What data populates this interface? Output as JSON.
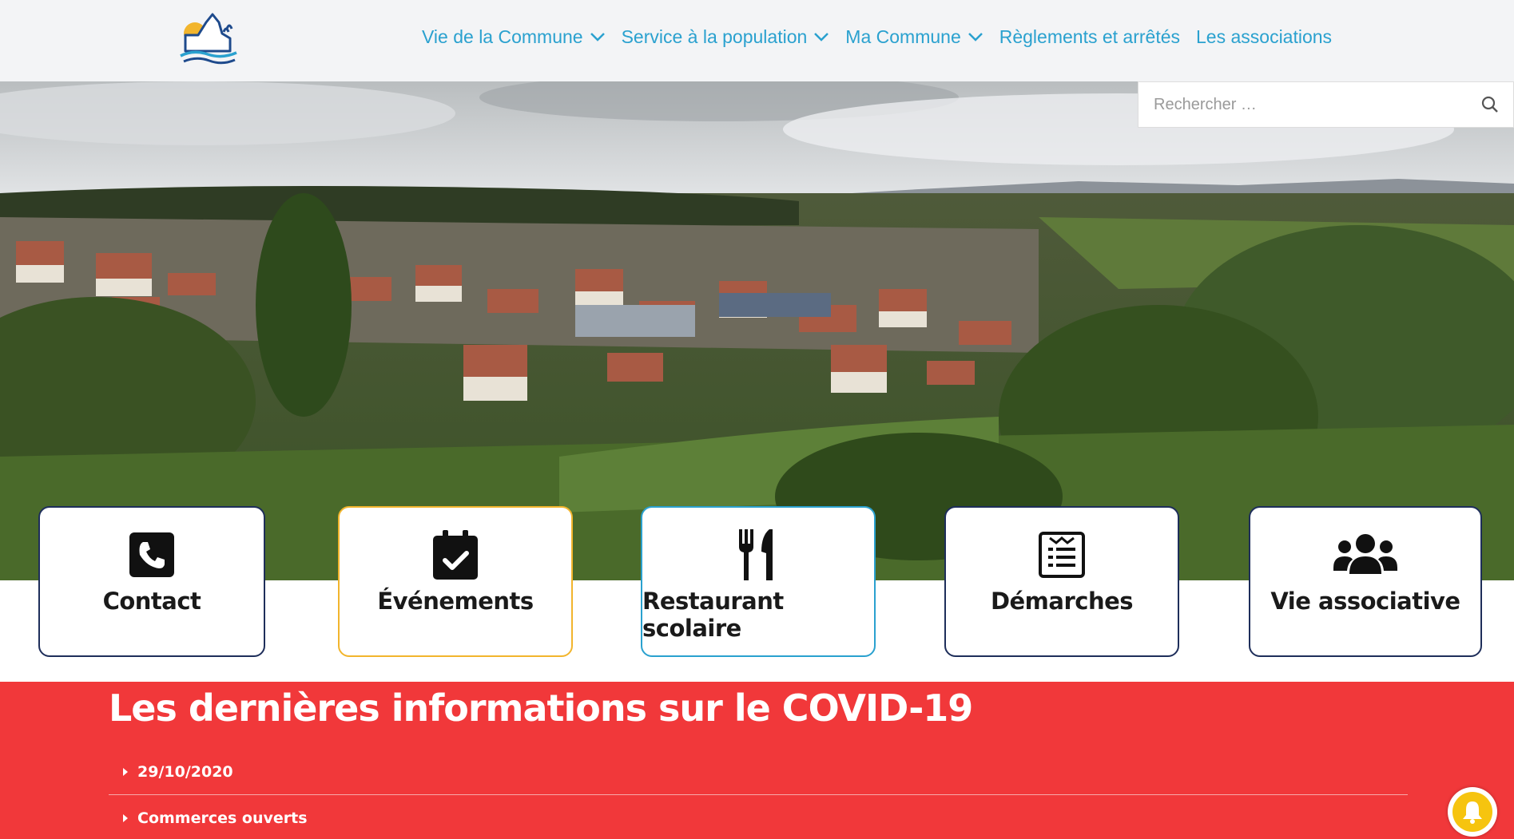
{
  "header": {
    "logo_icon": "village-logo-icon",
    "nav": [
      {
        "label": "Vie de la Commune",
        "has_dropdown": true
      },
      {
        "label": "Service à la population",
        "has_dropdown": true
      },
      {
        "label": "Ma Commune",
        "has_dropdown": true
      },
      {
        "label": "Règlements et arrêtés",
        "has_dropdown": false
      },
      {
        "label": "Les associations",
        "has_dropdown": false
      }
    ],
    "nav_color": "#2aa1cf"
  },
  "search": {
    "placeholder": "Rechercher …",
    "icon": "search-icon"
  },
  "cards": [
    {
      "label": "Contact",
      "icon": "phone-icon",
      "border_color": "#1e2e5a"
    },
    {
      "label": "Événements",
      "icon": "calendar-check-icon",
      "border_color": "#f2b52d"
    },
    {
      "label": "Restaurant scolaire",
      "icon": "utensils-icon",
      "border_color": "#2aa1cf"
    },
    {
      "label": "Démarches",
      "icon": "document-list-icon",
      "border_color": "#1e2e5a"
    },
    {
      "label": "Vie associative",
      "icon": "users-icon",
      "border_color": "#1e2e5a"
    }
  ],
  "covid": {
    "title": "Les dernières informations sur le COVID-19",
    "background": "#f1383a",
    "items": [
      {
        "label": "29/10/2020"
      },
      {
        "label": "Commerces ouverts"
      }
    ]
  },
  "notification": {
    "icon": "bell-icon",
    "color": "#f6c40f"
  }
}
